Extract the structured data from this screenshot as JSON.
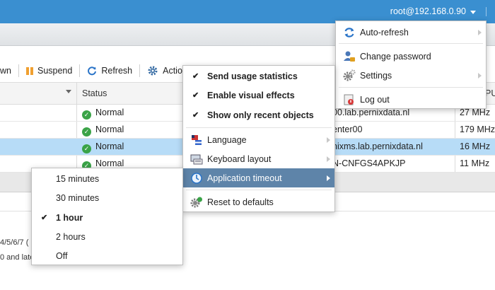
{
  "header": {
    "user": "root@192.168.0.90"
  },
  "toolbar": {
    "shutdown_fragment": "wn",
    "suspend": "Suspend",
    "refresh": "Refresh",
    "actions": "Actio"
  },
  "table": {
    "status_header": "Status",
    "right_header": "PU",
    "rows": [
      {
        "status": "Normal",
        "name": "00.lab.pernixdata.nl",
        "cpu": "27 MHz"
      },
      {
        "status": "Normal",
        "name": "enter00",
        "cpu": "179 MHz"
      },
      {
        "status": "Normal",
        "name": "nixms.lab.pernixdata.nl",
        "cpu": "16 MHz"
      },
      {
        "status": "Normal",
        "name": "N-CNFGS4APKJP",
        "cpu": "11 MHz"
      }
    ],
    "fragments": {
      "a": "4/5/6/7 (",
      "b": "0 and late"
    }
  },
  "user_menu": {
    "items": [
      {
        "label": "Auto-refresh",
        "icon": "refresh-icon"
      },
      {
        "label": "Change password",
        "icon": "key-user-icon"
      },
      {
        "label": "Settings",
        "icon": "gear-icon"
      },
      {
        "label": "Log out",
        "icon": "logout-icon"
      }
    ]
  },
  "settings_menu": {
    "items": [
      {
        "label": "Send usage statistics",
        "checked": true
      },
      {
        "label": "Enable visual effects",
        "checked": true
      },
      {
        "label": "Show only recent objects",
        "checked": true
      },
      {
        "label": "Language",
        "icon": "flag-icon"
      },
      {
        "label": "Keyboard layout",
        "icon": "keyboard-icon"
      },
      {
        "label": "Application timeout",
        "icon": "timeout-icon",
        "highlighted": true
      },
      {
        "label": "Reset to defaults",
        "icon": "reset-gear-icon"
      }
    ]
  },
  "timeout_menu": {
    "options": [
      "15 minutes",
      "30 minutes",
      "1 hour",
      "2 hours",
      "Off"
    ],
    "selected": "1 hour"
  },
  "colors": {
    "header": "#3a8fd0",
    "highlight": "#5e84a9",
    "selected_row": "#b7dcf7",
    "ok": "#3aa347"
  }
}
